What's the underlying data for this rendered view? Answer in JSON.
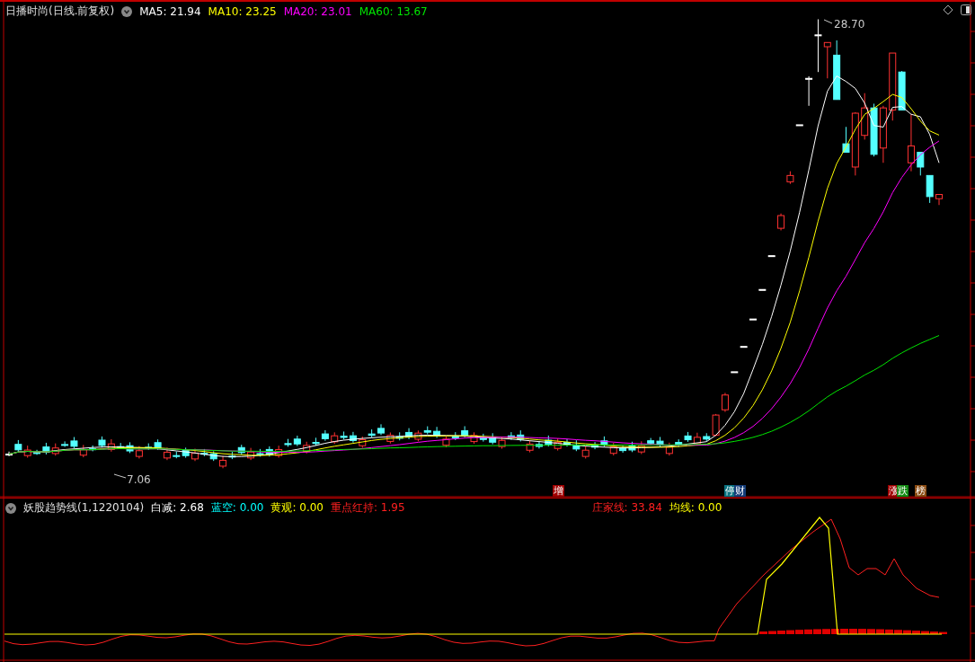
{
  "main_chart": {
    "title": "日播时尚(日线.前复权)",
    "ma_legend": [
      {
        "label": "MA5: 21.94",
        "color": "#ffffff"
      },
      {
        "label": "MA10: 23.25",
        "color": "#ffff00"
      },
      {
        "label": "MA20: 23.01",
        "color": "#ff00ff"
      },
      {
        "label": "MA60: 13.67",
        "color": "#00e600"
      }
    ],
    "high_label": "28.70",
    "low_label": "7.06"
  },
  "signal_badges": [
    {
      "text": "增",
      "color": "#a00000"
    },
    {
      "text": "停",
      "color": "#0a7280"
    },
    {
      "text": "财",
      "color": "#143c78"
    },
    {
      "text": "涨",
      "color": "#a00000"
    },
    {
      "text": "跌",
      "color": "#138a13"
    },
    {
      "text": "榜",
      "color": "#8a4a10"
    }
  ],
  "indicator": {
    "title": "妖股趋势线(1,1220104)",
    "values": [
      {
        "label": "白减: 2.68",
        "color": "#ffffff"
      },
      {
        "label": "蓝空: 0.00",
        "color": "#00ffff"
      },
      {
        "label": "黄观: 0.00",
        "color": "#ffff00"
      },
      {
        "label": "重点红持: 1.95",
        "color": "#ff2020"
      }
    ],
    "values_right": [
      {
        "label": "庄家线: 33.84",
        "color": "#ff2020"
      },
      {
        "label": "均线: 0.00",
        "color": "#ffff00"
      }
    ]
  }
}
